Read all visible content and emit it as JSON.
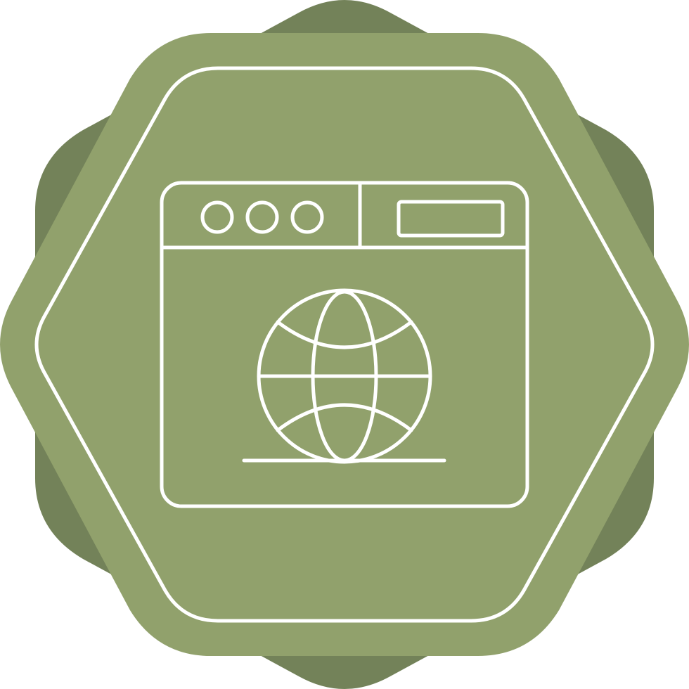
{
  "icon": {
    "name": "web-browser-globe-icon",
    "colors": {
      "background": "#ffffff",
      "badge_back": "#738259",
      "badge_front": "#91a16c",
      "stroke": "#ffffff"
    },
    "window_dots": 3
  }
}
